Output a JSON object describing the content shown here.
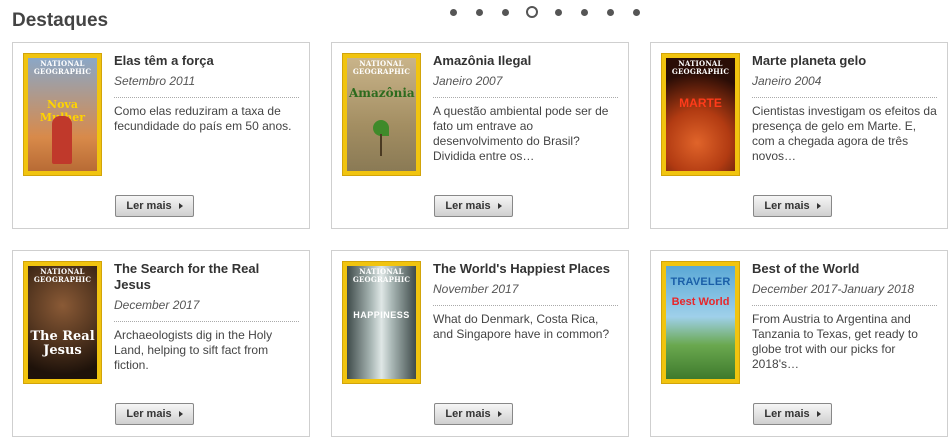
{
  "section_title": "Destaques",
  "carousel": {
    "dots": 8,
    "active_index": 3
  },
  "cards": [
    {
      "title": "Elas têm a força",
      "date": "Setembro 2011",
      "description": "Como elas reduziram a taxa de fecundidade do país em 50 anos.",
      "button": "Ler mais",
      "cover": {
        "masthead": "NATIONAL GEOGRAPHIC",
        "headline": "Nova Mulher",
        "bg": "#d88a4a",
        "bg2": "#8aa7c7",
        "headline_color": "#ffd400"
      }
    },
    {
      "title": "Amazônia Ilegal",
      "date": "Janeiro 2007",
      "description": "A questão ambiental pode ser de fato um entrave ao desenvolvimento do Brasil? Dividida entre os…",
      "button": "Ler mais",
      "cover": {
        "masthead": "NATIONAL GEOGRAPHIC",
        "headline": "Amazônia",
        "bg": "#c9b48a",
        "bg2": "#8a7a55",
        "headline_color": "#2d6b1e"
      }
    },
    {
      "title": "Marte planeta gelo",
      "date": "Janeiro 2004",
      "description": "Cientistas investigam os efeitos da presença de gelo em Marte. E, com a chegada agora de três novos…",
      "button": "Ler mais",
      "cover": {
        "masthead": "NATIONAL GEOGRAPHIC",
        "headline": "MARTE",
        "bg": "#b23b12",
        "bg2": "#2a0d06",
        "headline_color": "#ff3b1a"
      }
    },
    {
      "title": "The Search for the Real Jesus",
      "date": "December 2017",
      "description": "Archaeologists dig in the Holy Land, helping to sift fact from fiction.",
      "button": "Ler mais",
      "cover": {
        "masthead": "NATIONAL GEOGRAPHIC",
        "headline": "The Real Jesus",
        "bg": "#5a3a22",
        "bg2": "#1e120a",
        "headline_color": "#ffffff"
      }
    },
    {
      "title": "The World's Happiest Places",
      "date": "November 2017",
      "description": "What do Denmark, Costa Rica, and Singapore have in common?",
      "button": "Ler mais",
      "cover": {
        "masthead": "NATIONAL GEOGRAPHIC",
        "headline": "HAPPINESS",
        "bg": "#a9b7b5",
        "bg2": "#3f4b4a",
        "headline_color": "#ffffff"
      }
    },
    {
      "title": "Best of the World",
      "date": "December 2017-January 2018",
      "description": "From Austria to Argentina and Tanzania to Texas, get ready to globe trot with our picks for 2018's…",
      "button": "Ler mais",
      "cover": {
        "masthead": "TRAVELER",
        "headline": "Best World",
        "bg": "#5aa8d6",
        "bg2": "#3e7a2c",
        "headline_color": "#e8262a"
      }
    }
  ]
}
